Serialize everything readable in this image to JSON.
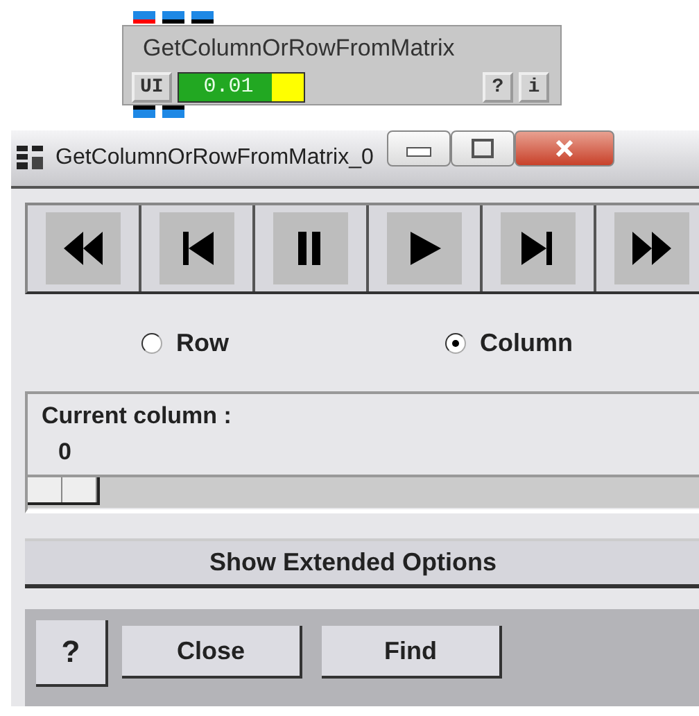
{
  "node": {
    "title": "GetColumnOrRowFromMatrix",
    "ui_button": "UI",
    "progress": {
      "value": "0.01",
      "level": 0.75
    },
    "help_button": "?",
    "info_button": "i",
    "input_ports": [
      {
        "color": "#ff0000"
      },
      {
        "color": "#000000"
      },
      {
        "color": "#000000"
      }
    ],
    "output_ports": [
      {
        "color": "#000000"
      },
      {
        "color": "#000000"
      }
    ]
  },
  "window": {
    "title": "GetColumnOrRowFromMatrix_0"
  },
  "transport": [
    {
      "kind": "rewind"
    },
    {
      "kind": "previous"
    },
    {
      "kind": "pause"
    },
    {
      "kind": "play"
    },
    {
      "kind": "next"
    },
    {
      "kind": "fast_forward"
    }
  ],
  "radios": [
    {
      "label": "Row",
      "selected": false
    },
    {
      "label": "Column",
      "selected": true
    }
  ],
  "slider": {
    "label": "Current column :",
    "value": "0",
    "level": 0
  },
  "extended_button": "Show Extended Options",
  "buttons": [
    {
      "kind": "help",
      "label": "?"
    },
    {
      "kind": "text",
      "label": "Close"
    },
    {
      "kind": "text",
      "label": "Find"
    }
  ]
}
